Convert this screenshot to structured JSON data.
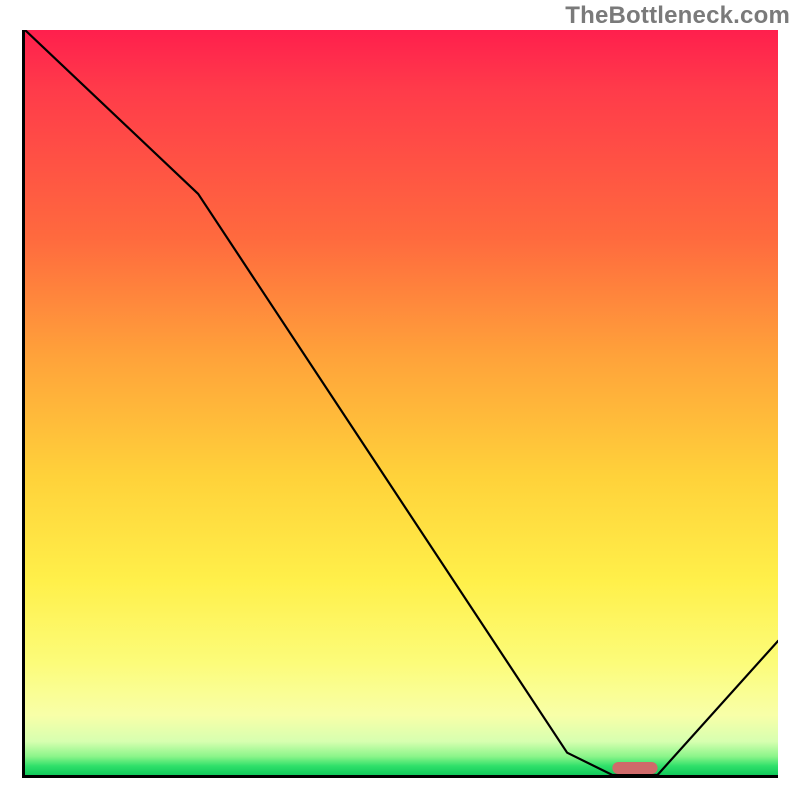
{
  "watermark": "TheBottleneck.com",
  "chart_data": {
    "type": "line",
    "title": "",
    "xlabel": "",
    "ylabel": "",
    "xlim": [
      0,
      100
    ],
    "ylim": [
      0,
      100
    ],
    "background_gradient": {
      "direction": "vertical",
      "stops": [
        {
          "pos": 0,
          "color": "#ff1f4d",
          "meaning": "high-bottleneck"
        },
        {
          "pos": 50,
          "color": "#ffb53a"
        },
        {
          "pos": 80,
          "color": "#fff04a"
        },
        {
          "pos": 100,
          "color": "#10c95a",
          "meaning": "no-bottleneck"
        }
      ]
    },
    "series": [
      {
        "name": "bottleneck-curve",
        "x": [
          0,
          23,
          72,
          78,
          84,
          100
        ],
        "values": [
          100,
          78,
          3,
          0,
          0,
          18
        ]
      }
    ],
    "optimal_marker": {
      "x_range": [
        78,
        84
      ],
      "y": 0,
      "color": "#cf6a6a"
    },
    "annotations": []
  }
}
